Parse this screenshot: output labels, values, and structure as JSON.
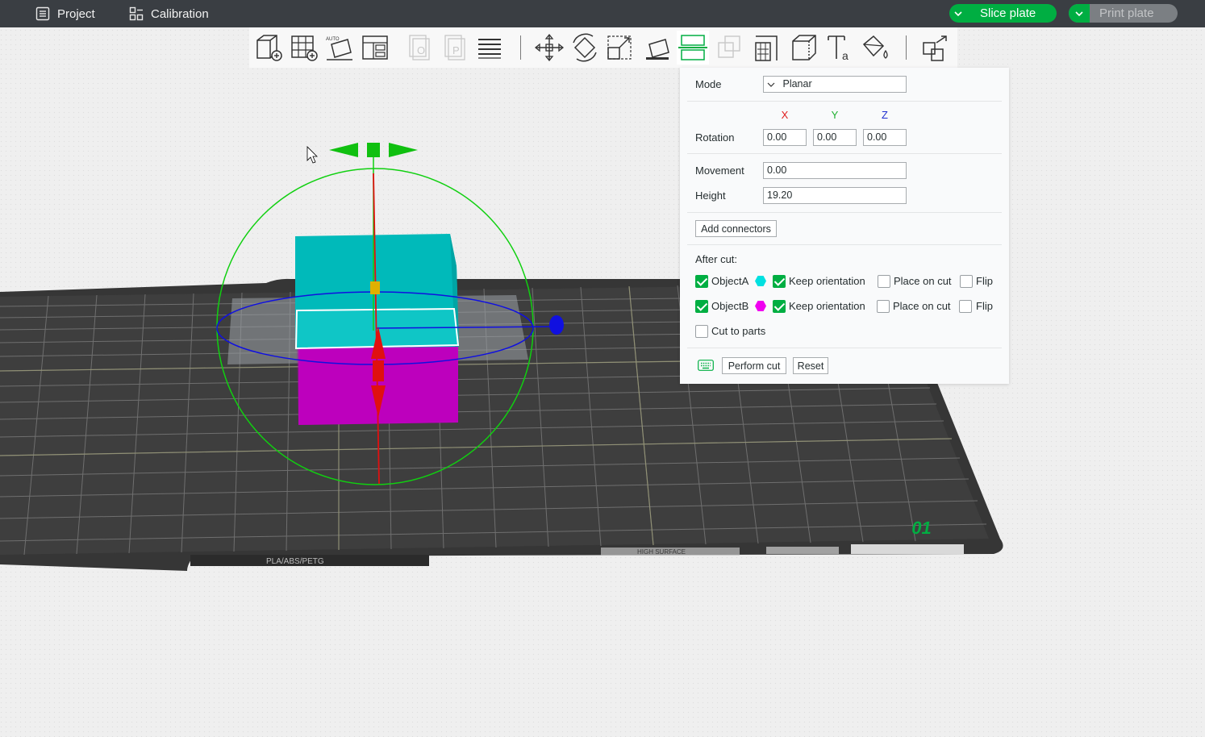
{
  "topbar": {
    "project_label": "Project",
    "calibration_label": "Calibration",
    "slice_label": "Slice plate",
    "print_label": "Print plate"
  },
  "toolbar": {
    "tools": [
      "add-object",
      "arrange-grid",
      "auto-orient",
      "layout-plate",
      "paste-disabled",
      "paste-plate-disabled",
      "layers",
      "move",
      "rotate",
      "scale",
      "lay-on-face",
      "cut",
      "mesh-boolean-disabled",
      "support-paint",
      "seam-paint",
      "text",
      "paint-bucket",
      "assembly"
    ],
    "active_tool": "cut"
  },
  "plate": {
    "label_left": "PLA/ABS/PETG",
    "label_center": "HIGH SURFACE",
    "plate_number": "01"
  },
  "cut_panel": {
    "mode_label": "Mode",
    "mode_value": "Planar",
    "axis_x": "X",
    "axis_y": "Y",
    "axis_z": "Z",
    "rotation_label": "Rotation",
    "rotation_x": "0.00",
    "rotation_y": "0.00",
    "rotation_z": "0.00",
    "movement_label": "Movement",
    "movement_value": "0.00",
    "height_label": "Height",
    "height_value": "19.20",
    "add_connectors_label": "Add connectors",
    "after_cut_label": "After cut:",
    "object_a_label": "ObjectA",
    "object_b_label": "ObjectB",
    "keep_orientation_label": "Keep orientation",
    "place_on_cut_label": "Place on cut",
    "flip_label": "Flip",
    "cut_to_parts_label": "Cut to parts",
    "perform_cut_label": "Perform cut",
    "reset_label": "Reset",
    "object_a_keep": true,
    "object_a_checked": true,
    "object_a_place": false,
    "object_a_flip": false,
    "object_b_checked": true,
    "object_b_keep": true,
    "object_b_place": false,
    "object_b_flip": false,
    "cut_to_parts": false
  },
  "colors": {
    "accent": "#00ae42",
    "object_a": "#00c0c0",
    "object_b": "#c000c0",
    "axis_x": "#e02020",
    "axis_y": "#20b030",
    "axis_z": "#2030d0"
  }
}
